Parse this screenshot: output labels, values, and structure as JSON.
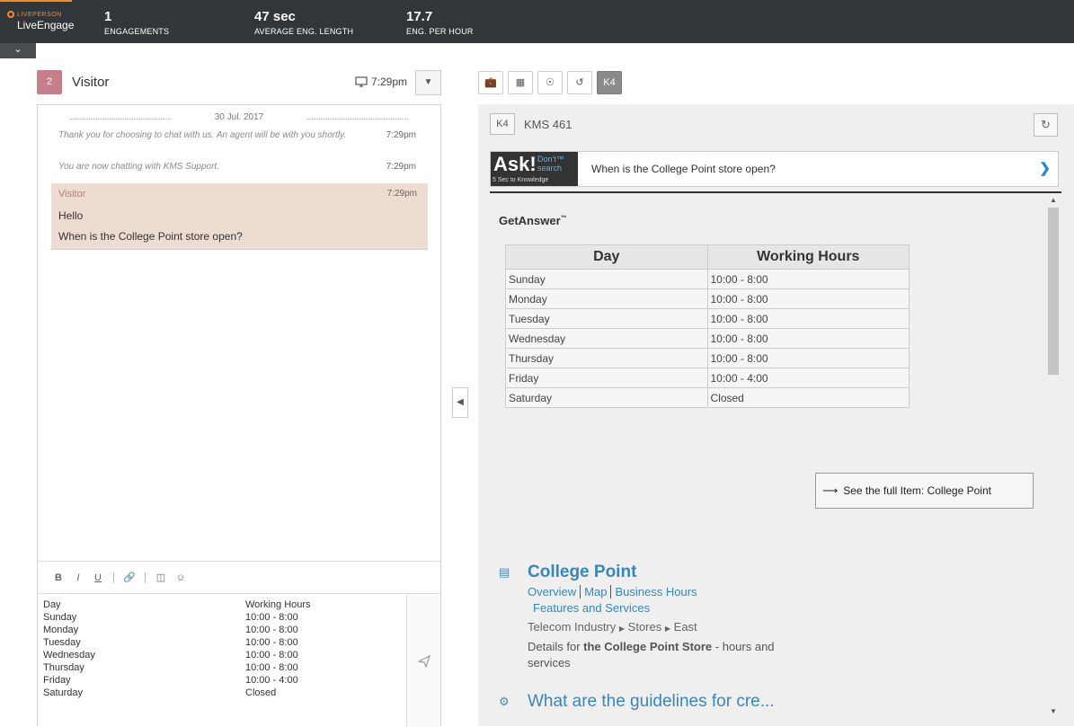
{
  "app": {
    "brand_small": "LIVEPERSON",
    "brand_name": "LiveEngage"
  },
  "stats": [
    {
      "value": "1",
      "label": "ENGAGEMENTS"
    },
    {
      "value": "47 sec",
      "label": "AVERAGE ENG. LENGTH"
    },
    {
      "value": "17.7",
      "label": "ENG. PER HOUR"
    }
  ],
  "visitor": {
    "count": "2",
    "name": "Visitor",
    "time": "7:29pm"
  },
  "chat": {
    "date": "30 Jul. 2017",
    "system_messages": [
      {
        "text": "Thank you for choosing to chat with us. An agent will be with you shortly.",
        "time": "7:29pm"
      },
      {
        "text": "You are now chatting with KMS Support.",
        "time": "7:29pm"
      }
    ],
    "visitor_message": {
      "sender": "Visitor",
      "time": "7:29pm",
      "lines": [
        "Hello",
        "When is the College Point store open?"
      ]
    }
  },
  "editor": {
    "tools": {
      "bold": "B",
      "italic": "I",
      "underline": "U"
    },
    "rows": [
      [
        "Day",
        "Working Hours"
      ],
      [
        "Sunday",
        "10:00 - 8:00"
      ],
      [
        "Monday",
        "10:00 - 8:00"
      ],
      [
        "Tuesday",
        "10:00 - 8:00"
      ],
      [
        "Wednesday",
        "10:00 - 8:00"
      ],
      [
        "Thursday",
        "10:00 - 8:00"
      ],
      [
        "Friday",
        "10:00 - 4:00"
      ],
      [
        "Saturday",
        "Closed"
      ]
    ]
  },
  "widget": {
    "active_tab": "K4",
    "header": {
      "badge": "K4",
      "title": "KMS 461"
    },
    "ask": {
      "logo_main": "Ask!",
      "logo_dont": "Don't™",
      "logo_search": "search",
      "logo_sub": "5 Sec to Knowledge",
      "question": "When is the College Point store open?"
    },
    "answer": {
      "label": "GetAnswer",
      "tm": "™",
      "table_headers": [
        "Day",
        "Working Hours"
      ],
      "table_rows": [
        [
          "Sunday",
          "10:00 - 8:00"
        ],
        [
          "Monday",
          "10:00 - 8:00"
        ],
        [
          "Tuesday",
          "10:00 - 8:00"
        ],
        [
          "Wednesday",
          "10:00 - 8:00"
        ],
        [
          "Thursday",
          "10:00 - 8:00"
        ],
        [
          "Friday",
          "10:00 - 4:00"
        ],
        [
          "Saturday",
          "Closed"
        ]
      ],
      "full_item_label": "See the full Item: College Point"
    },
    "results": [
      {
        "title": "College Point",
        "links": [
          "Overview",
          "Map",
          "Business Hours",
          "Features and Services"
        ],
        "breadcrumb": [
          "Telecom Industry",
          "Stores",
          "East"
        ],
        "desc_pre": "Details for ",
        "desc_bold": "the College Point Store",
        "desc_post": " - hours and services"
      },
      {
        "title": "What are the guidelines for cre..."
      }
    ]
  },
  "colors": {
    "topbar": "#333638",
    "accent": "#f28c28",
    "visitor_badge": "#c57f8a",
    "visitor_bubble": "#ecdcd2",
    "link": "#3a86b8"
  }
}
